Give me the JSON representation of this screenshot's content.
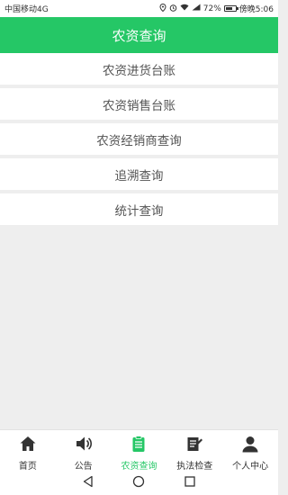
{
  "status_bar": {
    "carrier": "中国移动4G",
    "battery": "72%",
    "battery_level": 0.72,
    "time": "傍晚5:06"
  },
  "header": {
    "title": "农资查询"
  },
  "menu": {
    "items": [
      {
        "label": "农资进货台账"
      },
      {
        "label": "农资销售台账"
      },
      {
        "label": "农资经销商查询"
      },
      {
        "label": "追溯查询"
      },
      {
        "label": "统计查询"
      }
    ]
  },
  "bottom_nav": {
    "items": [
      {
        "label": "首页",
        "icon": "home-icon"
      },
      {
        "label": "公告",
        "icon": "speaker-icon"
      },
      {
        "label": "农资查询",
        "icon": "clipboard-icon"
      },
      {
        "label": "执法检查",
        "icon": "edit-icon"
      },
      {
        "label": "个人中心",
        "icon": "user-icon"
      }
    ],
    "active_index": 2
  },
  "colors": {
    "accent": "#25c766",
    "background": "#eeeeee"
  }
}
